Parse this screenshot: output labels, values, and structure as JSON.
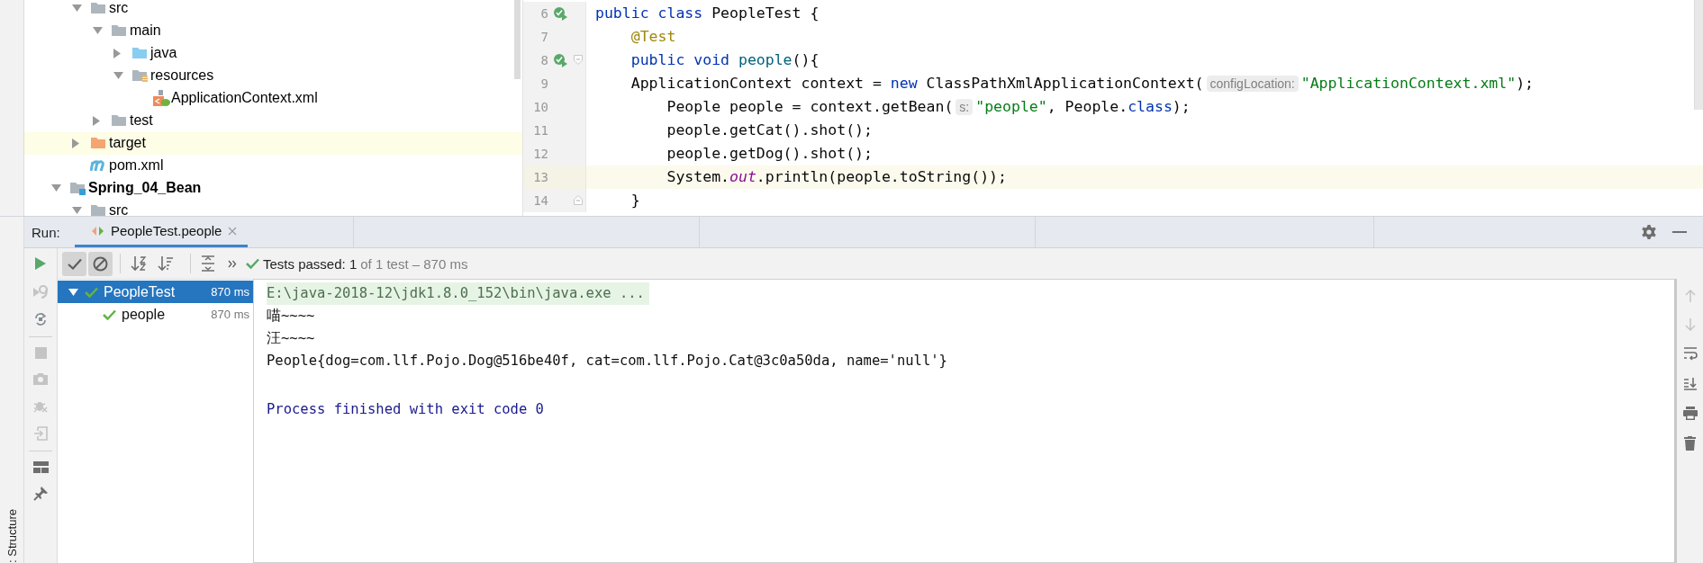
{
  "project_tree": {
    "items": [
      {
        "children": [
          {
            "label": "src",
            "kind": "folder",
            "expanded": true,
            "children": [
              {
                "label": "main",
                "kind": "folder",
                "expanded": true,
                "children": [
                  {
                    "label": "java",
                    "kind": "source-folder",
                    "expanded": false
                  },
                  {
                    "label": "resources",
                    "kind": "resource-folder",
                    "expanded": true,
                    "children": [
                      {
                        "label": "ApplicationContext.xml",
                        "kind": "spring-xml"
                      }
                    ]
                  }
                ]
              },
              {
                "label": "test",
                "kind": "folder",
                "expanded": false
              }
            ]
          },
          {
            "label": "target",
            "kind": "excluded-folder",
            "expanded": false,
            "highlighted": true
          },
          {
            "label": "pom.xml",
            "kind": "maven"
          }
        ]
      },
      {
        "label": "Spring_04_Bean",
        "kind": "module",
        "expanded": true,
        "children": [
          {
            "label": "src",
            "kind": "folder",
            "expanded": true
          }
        ]
      }
    ]
  },
  "editor": {
    "lines": [
      {
        "number": "6",
        "run_marker": true,
        "fold_start": false,
        "fold_end": false,
        "current": false,
        "tokens": [
          {
            "kind": "kw",
            "text": "public class"
          },
          {
            "kind": "plain",
            "text": " PeopleTest {"
          }
        ]
      },
      {
        "number": "7",
        "run_marker": false,
        "fold_start": false,
        "fold_end": false,
        "current": false,
        "tokens": [
          {
            "kind": "annotation",
            "text": "    @Test"
          }
        ]
      },
      {
        "number": "8",
        "run_marker": true,
        "fold_start": true,
        "fold_end": false,
        "current": false,
        "tokens": [
          {
            "kind": "kw",
            "text": "    public void "
          },
          {
            "kind": "method",
            "text": "people"
          },
          {
            "kind": "plain",
            "text": "(){"
          }
        ]
      },
      {
        "number": "9",
        "run_marker": false,
        "fold_start": false,
        "fold_end": false,
        "current": false,
        "tokens": [
          {
            "kind": "plain",
            "text": "    ApplicationContext context = "
          },
          {
            "kind": "kw",
            "text": "new"
          },
          {
            "kind": "plain",
            "text": " ClassPathXmlApplicationContext("
          },
          {
            "kind": "hint",
            "text": "configLocation:"
          },
          {
            "kind": "string",
            "text": "\"ApplicationContext.xml\""
          },
          {
            "kind": "plain",
            "text": ");"
          }
        ]
      },
      {
        "number": "10",
        "run_marker": false,
        "fold_start": false,
        "fold_end": false,
        "current": false,
        "tokens": [
          {
            "kind": "plain",
            "text": "        People people = context.getBean("
          },
          {
            "kind": "hint",
            "text": "s:"
          },
          {
            "kind": "string",
            "text": "\"people\""
          },
          {
            "kind": "plain",
            "text": ", People."
          },
          {
            "kind": "kw",
            "text": "class"
          },
          {
            "kind": "plain",
            "text": ");"
          }
        ]
      },
      {
        "number": "11",
        "run_marker": false,
        "fold_start": false,
        "fold_end": false,
        "current": false,
        "tokens": [
          {
            "kind": "plain",
            "text": "        people.getCat().shot();"
          }
        ]
      },
      {
        "number": "12",
        "run_marker": false,
        "fold_start": false,
        "fold_end": false,
        "current": false,
        "tokens": [
          {
            "kind": "plain",
            "text": "        people.getDog().shot();"
          }
        ]
      },
      {
        "number": "13",
        "run_marker": false,
        "fold_start": false,
        "fold_end": false,
        "current": true,
        "tokens": [
          {
            "kind": "plain",
            "text": "        System."
          },
          {
            "kind": "static",
            "text": "out"
          },
          {
            "kind": "plain",
            "text": ".println(people.toString());"
          }
        ]
      },
      {
        "number": "14",
        "run_marker": false,
        "fold_start": false,
        "fold_end": true,
        "current": false,
        "tokens": [
          {
            "kind": "plain",
            "text": "    }"
          }
        ]
      }
    ]
  },
  "run_panel": {
    "label": "Run:",
    "tabs": [
      {
        "label": "PeopleTest.people",
        "selected": true
      }
    ],
    "filter_toggles": [
      {
        "pressed": true
      },
      {
        "pressed": true
      }
    ],
    "status": {
      "summary": "Tests passed: 1",
      "detail": "of 1 test – 870 ms"
    },
    "tests": [
      {
        "label": "PeopleTest",
        "time": "870 ms",
        "passed": true,
        "selected": true,
        "expanded": true,
        "children": [
          {
            "label": "people",
            "time": "870 ms",
            "passed": true,
            "selected": false
          }
        ]
      }
    ],
    "console": [
      {
        "kind": "command",
        "text": "E:\\java-2018-12\\jdk1.8.0_152\\bin\\java.exe ..."
      },
      {
        "kind": "output",
        "text": "喵~~~~"
      },
      {
        "kind": "output",
        "text": "汪~~~~"
      },
      {
        "kind": "output",
        "text": "People{dog=com.llf.Pojo.Dog@516be40f, cat=com.llf.Pojo.Cat@3c0a50da, name='null'}"
      },
      {
        "kind": "exit",
        "text": "Process finished with exit code 0"
      }
    ]
  },
  "side_strip": {
    "label": ": Structure"
  }
}
